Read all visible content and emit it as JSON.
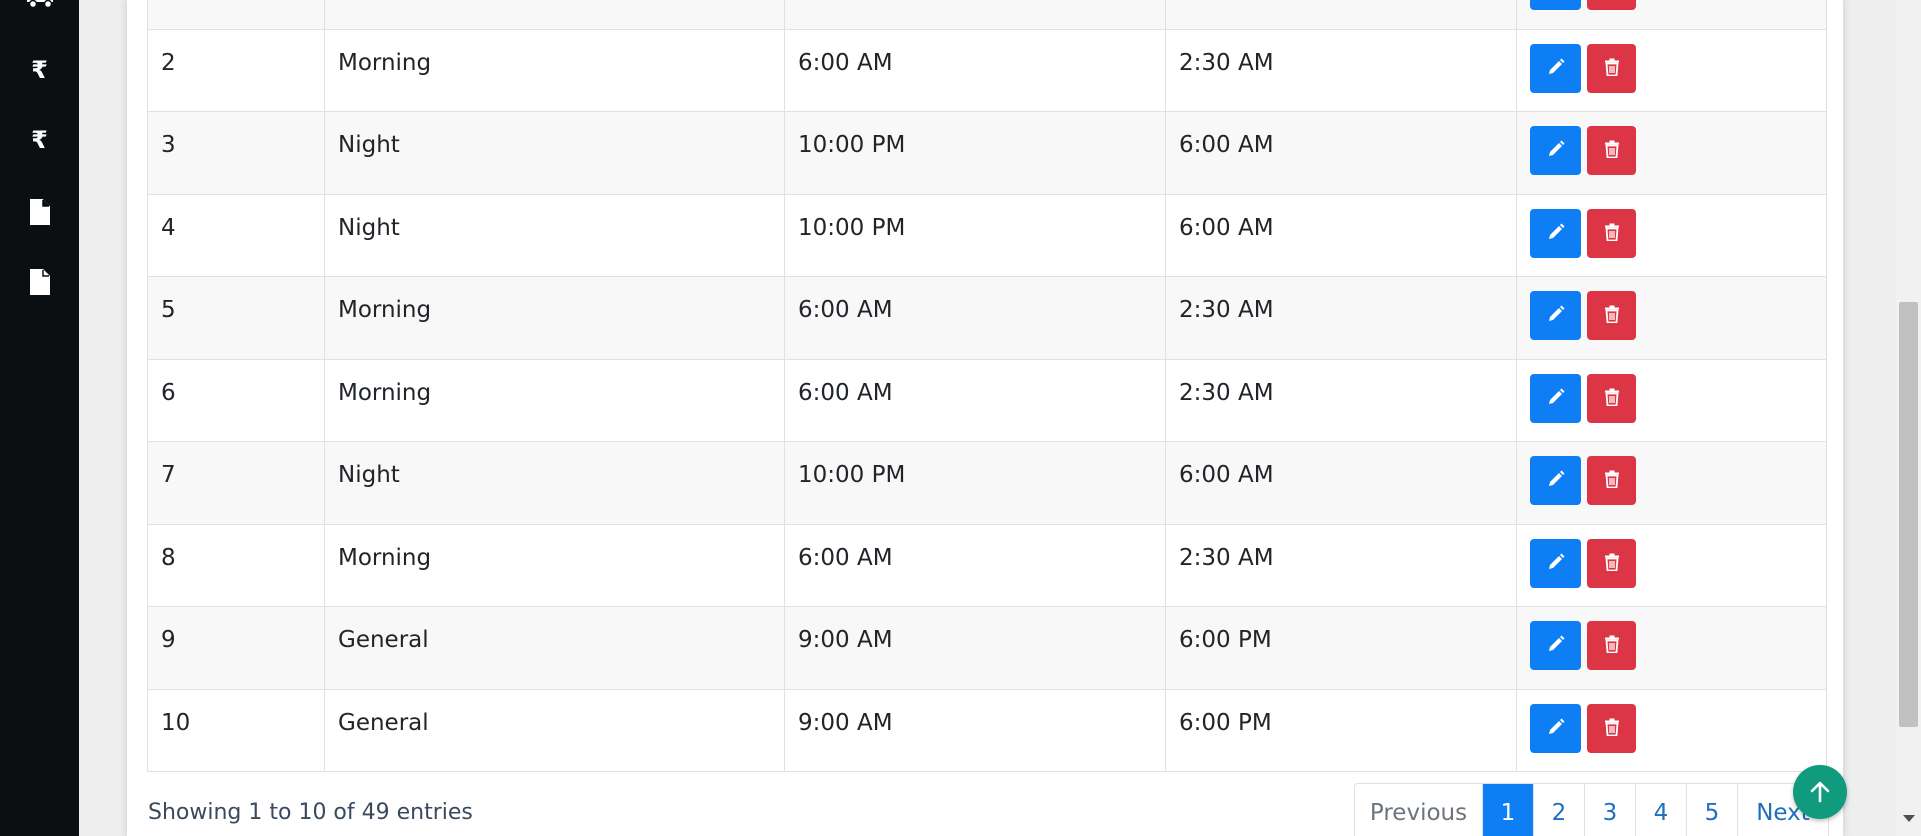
{
  "sidebar": {
    "icons": [
      "truck-icon",
      "rupee-icon",
      "rupee-icon",
      "document-icon",
      "document-icon"
    ],
    "rupee_symbol": "₹"
  },
  "table": {
    "rows": [
      {
        "no": "",
        "shift": "",
        "start": "",
        "end": ""
      },
      {
        "no": "2",
        "shift": "Morning",
        "start": "6:00 AM",
        "end": "2:30 AM"
      },
      {
        "no": "3",
        "shift": "Night",
        "start": "10:00 PM",
        "end": "6:00 AM"
      },
      {
        "no": "4",
        "shift": "Night",
        "start": "10:00 PM",
        "end": "6:00 AM"
      },
      {
        "no": "5",
        "shift": "Morning",
        "start": "6:00 AM",
        "end": "2:30 AM"
      },
      {
        "no": "6",
        "shift": "Morning",
        "start": "6:00 AM",
        "end": "2:30 AM"
      },
      {
        "no": "7",
        "shift": "Night",
        "start": "10:00 PM",
        "end": "6:00 AM"
      },
      {
        "no": "8",
        "shift": "Morning",
        "start": "6:00 AM",
        "end": "2:30 AM"
      },
      {
        "no": "9",
        "shift": "General",
        "start": "9:00 AM",
        "end": "6:00 PM"
      },
      {
        "no": "10",
        "shift": "General",
        "start": "9:00 AM",
        "end": "6:00 PM"
      }
    ]
  },
  "footer": {
    "info": "Showing 1 to 10 of 49 entries"
  },
  "pagination": {
    "previous": "Previous",
    "pages": [
      "1",
      "2",
      "3",
      "4",
      "5"
    ],
    "active_page": "1",
    "next": "Next"
  },
  "colors": {
    "edit": "#0d7ef4",
    "delete": "#dc3545",
    "to_top": "#109a7e",
    "sidebar": "#0b0f12"
  }
}
